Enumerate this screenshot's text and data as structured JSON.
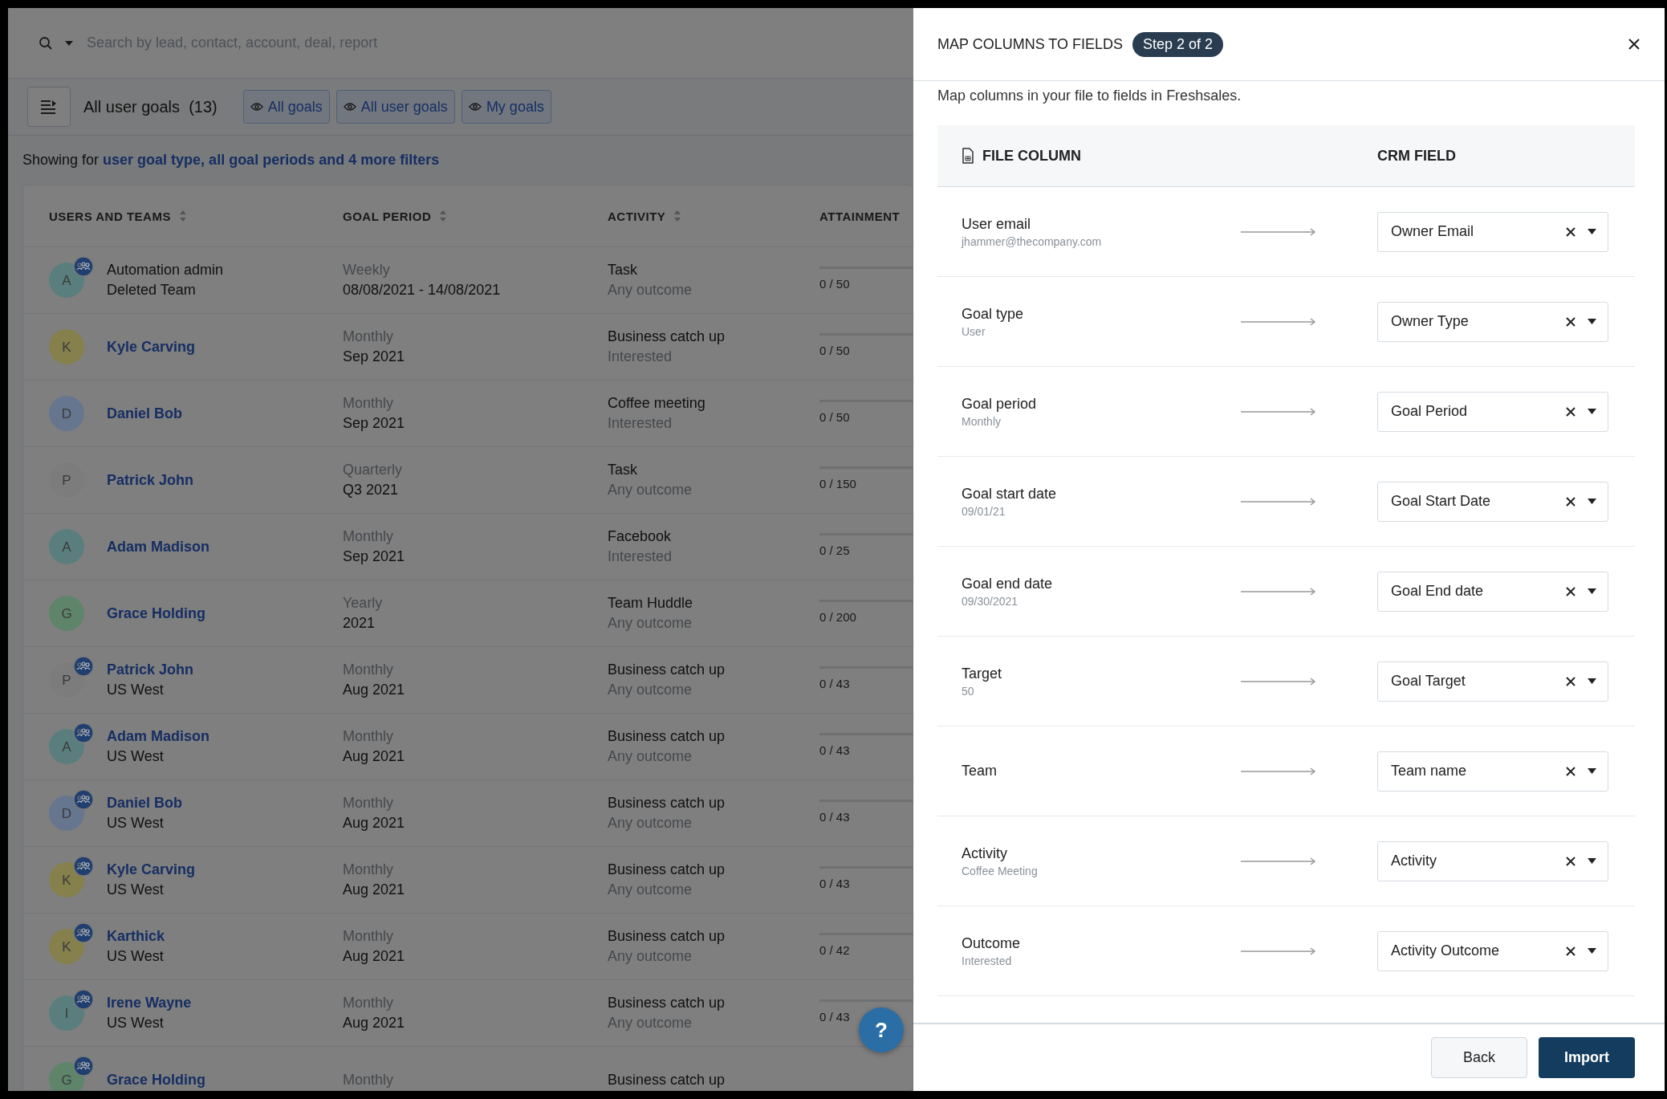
{
  "search": {
    "placeholder": "Search by lead, contact, account, deal, report"
  },
  "toolbar": {
    "title": "All user goals",
    "count": "(13)",
    "views": [
      {
        "label": "All goals"
      },
      {
        "label": "All user goals"
      },
      {
        "label": "My goals"
      }
    ]
  },
  "filter_summary": {
    "prefix": "Showing for",
    "link": "user goal type, all goal periods and 4 more filters"
  },
  "table": {
    "columns": [
      "USERS AND TEAMS",
      "GOAL PERIOD",
      "ACTIVITY",
      "ATTAINMENT"
    ],
    "rows": [
      {
        "initial": "A",
        "color": "#5a7e7e",
        "team": true,
        "linked": false,
        "name": "Automation admin",
        "team_name": "Deleted Team",
        "period_type": "Weekly",
        "period": "08/08/2021 - 14/08/2021",
        "activity": "Task",
        "outcome": "Any outcome",
        "attainment": "0 / 50",
        "level": 0
      },
      {
        "initial": "K",
        "color": "#86804c",
        "team": false,
        "linked": true,
        "name": "Kyle Carving",
        "period_type": "Monthly",
        "period": "Sep 2021",
        "activity": "Business catch up",
        "outcome": "Interested",
        "attainment": "0 / 50",
        "level": 0
      },
      {
        "initial": "D",
        "color": "#66768e",
        "team": false,
        "linked": true,
        "name": "Daniel Bob",
        "period_type": "Monthly",
        "period": "Sep 2021",
        "activity": "Coffee meeting",
        "outcome": "Interested",
        "attainment": "0 / 50",
        "level": 0
      },
      {
        "initial": "P",
        "color": "#7c7c7c",
        "team": false,
        "linked": true,
        "name": "Patrick John",
        "period_type": "Quarterly",
        "period": "Q3 2021",
        "activity": "Task",
        "outcome": "Any outcome",
        "attainment": "0 / 150",
        "level": 0
      },
      {
        "initial": "A",
        "color": "#5a7e7e",
        "team": false,
        "linked": true,
        "name": "Adam Madison",
        "period_type": "Monthly",
        "period": "Sep 2021",
        "activity": "Facebook",
        "outcome": "Interested",
        "attainment": "0 / 25",
        "level": 0
      },
      {
        "initial": "G",
        "color": "#5e846a",
        "team": false,
        "linked": true,
        "name": "Grace Holding",
        "period_type": "Yearly",
        "period": "2021",
        "activity": "Team Huddle",
        "outcome": "Any outcome",
        "attainment": "0 / 200",
        "level": 0
      },
      {
        "initial": "P",
        "color": "#7c7c7c",
        "team": true,
        "linked": true,
        "name": "Patrick John",
        "team_name": "US West",
        "period_type": "Monthly",
        "period": "Aug 2021",
        "activity": "Business catch up",
        "outcome": "Any outcome",
        "attainment": "0 / 43",
        "level": 0
      },
      {
        "initial": "A",
        "color": "#5a7e7e",
        "team": true,
        "linked": true,
        "name": "Adam Madison",
        "team_name": "US West",
        "period_type": "Monthly",
        "period": "Aug 2021",
        "activity": "Business catch up",
        "outcome": "Any outcome",
        "attainment": "0 / 43",
        "level": 0
      },
      {
        "initial": "D",
        "color": "#66768e",
        "team": true,
        "linked": true,
        "name": "Daniel Bob",
        "team_name": "US West",
        "period_type": "Monthly",
        "period": "Aug 2021",
        "activity": "Business catch up",
        "outcome": "Any outcome",
        "attainment": "0 / 43",
        "level": 0
      },
      {
        "initial": "K",
        "color": "#86804c",
        "team": true,
        "linked": true,
        "name": "Kyle Carving",
        "team_name": "US West",
        "period_type": "Monthly",
        "period": "Aug 2021",
        "activity": "Business catch up",
        "outcome": "Any outcome",
        "attainment": "0 / 43",
        "level": 0
      },
      {
        "initial": "K",
        "color": "#86804c",
        "team": true,
        "linked": true,
        "name": "Karthick",
        "team_name": "US West",
        "period_type": "Monthly",
        "period": "Aug 2021",
        "activity": "Business catch up",
        "outcome": "Any outcome",
        "attainment": "0 / 42",
        "level": 0
      },
      {
        "initial": "I",
        "color": "#5a7e7e",
        "team": true,
        "linked": true,
        "name": "Irene Wayne",
        "team_name": "US West",
        "period_type": "Monthly",
        "period": "Aug 2021",
        "activity": "Business catch up",
        "outcome": "Any outcome",
        "attainment": "0 / 43",
        "level": 0
      },
      {
        "initial": "G",
        "color": "#5e846a",
        "team": true,
        "linked": true,
        "name": "Grace Holding",
        "period_type": "Monthly",
        "activity": "Business catch up"
      }
    ]
  },
  "help_button": "?",
  "drawer": {
    "title": "MAP COLUMNS TO FIELDS",
    "step": "Step 2 of 2",
    "description": "Map columns in your file to fields in Freshsales.",
    "columns": [
      "FILE COLUMN",
      "CRM FIELD"
    ],
    "mappings": [
      {
        "column": "User email",
        "sample": "jhammer@thecompany.com",
        "field": "Owner Email"
      },
      {
        "column": "Goal type",
        "sample": "User",
        "field": "Owner Type"
      },
      {
        "column": "Goal period",
        "sample": "Monthly",
        "field": "Goal Period"
      },
      {
        "column": "Goal start date",
        "sample": "09/01/21",
        "field": "Goal Start Date"
      },
      {
        "column": "Goal end date",
        "sample": "09/30/2021",
        "field": "Goal End date"
      },
      {
        "column": "Target",
        "sample": "50",
        "field": "Goal Target"
      },
      {
        "column": "Team",
        "field": "Team name"
      },
      {
        "column": "Activity",
        "sample": "Coffee Meeting",
        "field": "Activity"
      },
      {
        "column": "Outcome",
        "sample": "Interested",
        "field": "Activity Outcome"
      }
    ],
    "buttons": {
      "back": "Back",
      "import": "Import"
    }
  }
}
